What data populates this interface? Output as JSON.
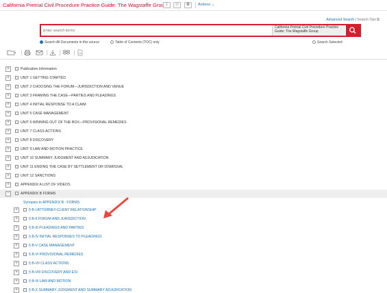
{
  "header": {
    "title": "California Pretrial Civil Procedure Practice Guide: The Wagstaffe Group",
    "info_icon": "info-icon",
    "star_icon": "star-icon",
    "gear_icon": "gear-icon",
    "actions_label": "Actions"
  },
  "search": {
    "advanced_label": "Advanced Search",
    "tips_label": "Search Tips",
    "placeholder": "Enter search terms",
    "source_label": "California Pretrial Civil Procedure Practice Guide: The Wagstaffe Group",
    "option_all": "Search All Documents in this source",
    "option_toc": "Table of Contents (TOC) only",
    "option_selected": "Search Selected"
  },
  "toolbar": [
    "folder-icon",
    "print-icon",
    "email-icon",
    "download-icon",
    "dropbox-icon",
    "document-icon"
  ],
  "tree": {
    "top_items": [
      "Publication Information",
      "UNIT 1 GETTING STARTED",
      "UNIT 2 CHOOSING THE FORUM—JURISDICTION AND VENUE",
      "UNIT 3 FRAMING THE CASE—PARTIES AND PLEADINGS",
      "UNIT 4 INITIAL RESPONSE TO A CLAIM",
      "UNIT 5 CASE MANAGEMENT",
      "UNIT 6 WINNING OUT OF THE BOX—PROVISIONAL REMEDIES",
      "UNIT 7 CLASS ACTIONS",
      "UNIT 8 DISCOVERY",
      "UNIT 9 LAW AND MOTION PRACTICE",
      "UNIT 10 SUMMARY JUDGMENT AND ADJUDICATION",
      "UNIT 11 ENDING THE CASE BY SETTLEMENT OR DISMISSAL",
      "UNIT 12 SANCTIONS",
      "APPENDIX A LIST OF VIDEOS"
    ],
    "expanded_item": "APPENDIX B FORMS",
    "synopsis": "Synopsis to APPENDIX B : FORMS",
    "children": [
      "§ B-I ATTORNEY-CLIENT RELATIONSHIP",
      "§ B-II FORUM AND JURISDICTION",
      "§ B-III PLEADINGS AND PARTIES",
      "§ B-IV INITIAL RESPONSES TO PLEADINGS",
      "§ B-V CASE MANAGEMENT",
      "§ B-VI PROVISIONAL REMEDIES",
      "§ B-VII CLASS ACTIONS",
      "§ B-VIII DISCOVERY AND ESI",
      "§ B-IX LAW AND MOTION",
      "§ B-X SUMMARY JUDGMENT AND SUMMARY ADJUDICATION"
    ]
  },
  "colors": {
    "accent_red": "#d31f2c",
    "link_blue": "#1a6fb5",
    "arrow": "#e8473b"
  }
}
